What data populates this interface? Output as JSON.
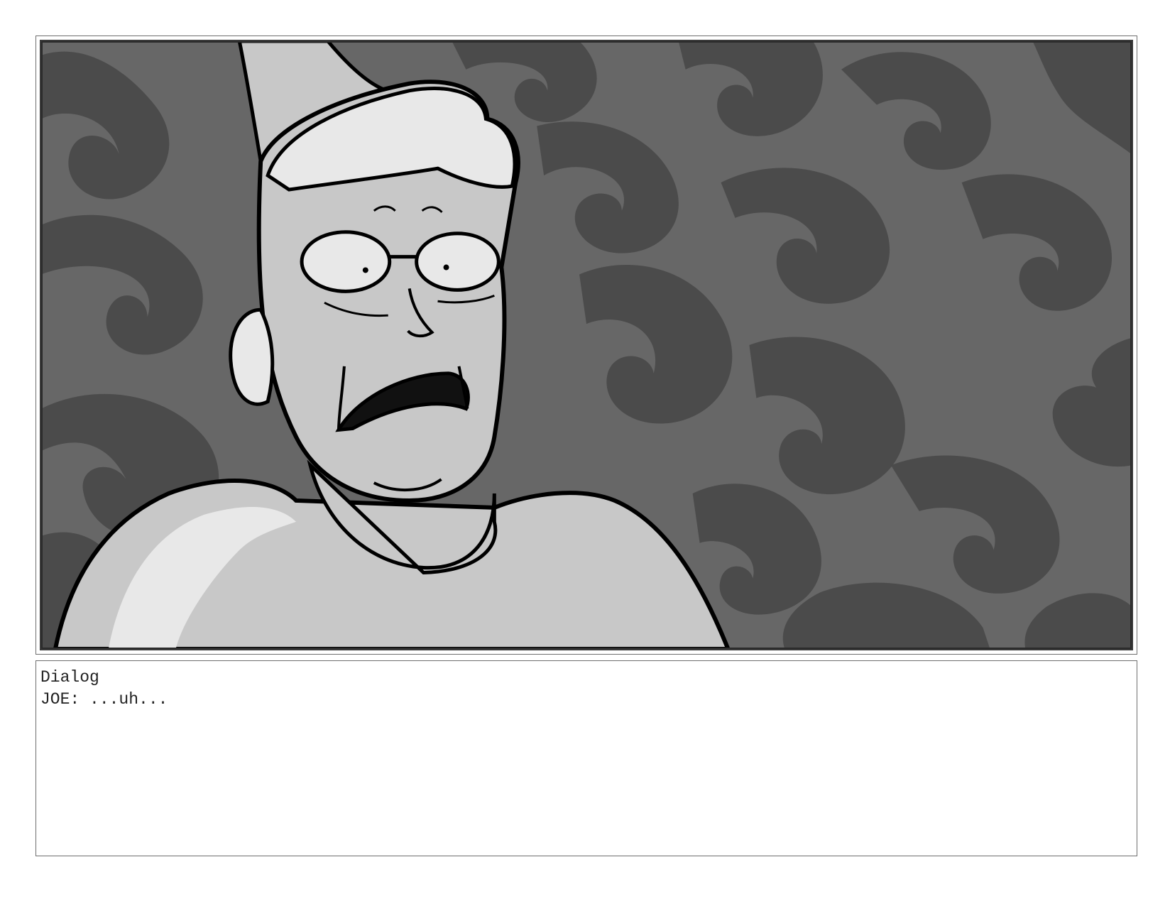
{
  "panel": {
    "shot": "close-up",
    "subject": "man-in-party-hat",
    "palette": {
      "background_light": "#676767",
      "background_dark": "#4b4b4b",
      "skin": "#c8c8c8",
      "highlight": "#e8e8e8",
      "ink": "#000000",
      "mouth": "#111111"
    }
  },
  "dialog": {
    "heading": "Dialog",
    "lines": [
      {
        "text": "JOE: ...uh..."
      }
    ]
  }
}
